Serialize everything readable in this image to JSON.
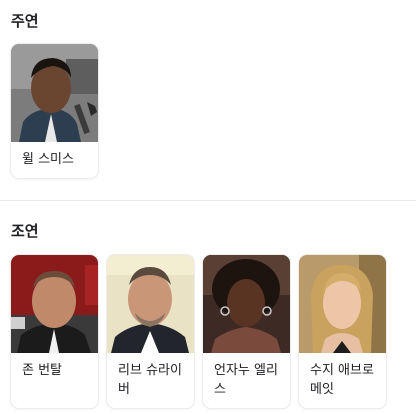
{
  "cast": {
    "title": "주연",
    "people": [
      {
        "name": "윌 스미스",
        "photo_icon": "person-photo-will-smith"
      }
    ]
  },
  "supporting": {
    "title": "조연",
    "people": [
      {
        "name": "존 번탈",
        "photo_icon": "person-photo-jon-bernthal"
      },
      {
        "name": "리브 슈라이버",
        "photo_icon": "person-photo-liev-schreiber"
      },
      {
        "name": "언자누 엘리스",
        "photo_icon": "person-photo-aunjanue-ellis"
      },
      {
        "name": "수지 애브로메잇",
        "photo_icon": "person-photo-suzy-abromeit"
      }
    ]
  }
}
